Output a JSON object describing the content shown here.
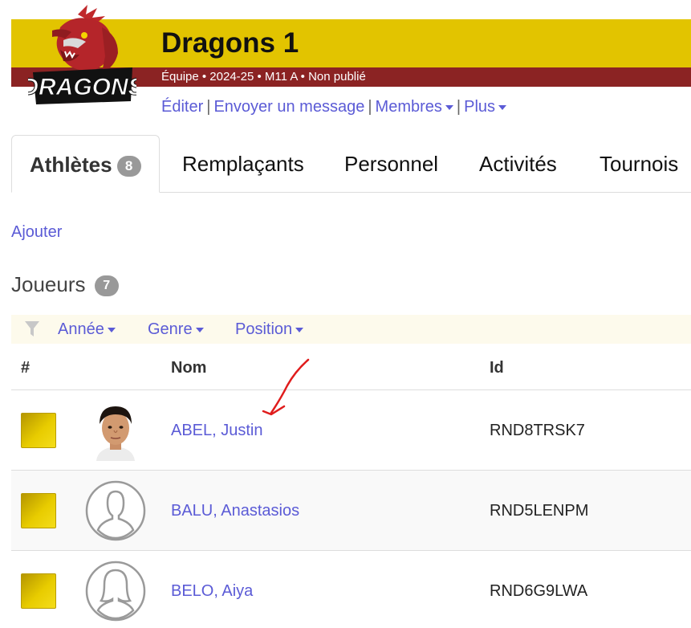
{
  "header": {
    "team_name": "Dragons 1",
    "meta": "Équipe • 2024-25 • M11 A • Non publié",
    "logo_text": "DRAGONS",
    "colors": {
      "primary": "#e2c400",
      "secondary": "#8b2323",
      "link": "#5b5bd6"
    }
  },
  "actions": {
    "edit": "Éditer",
    "send_message": "Envoyer un message",
    "members": "Membres",
    "more": "Plus",
    "separator": "|"
  },
  "tabs": [
    {
      "label": "Athlètes",
      "badge": "8",
      "active": true
    },
    {
      "label": "Remplaçants"
    },
    {
      "label": "Personnel"
    },
    {
      "label": "Activités"
    },
    {
      "label": "Tournois"
    }
  ],
  "add_label": "Ajouter",
  "section": {
    "title": "Joueurs",
    "count": "7"
  },
  "filters": {
    "icon": "filter-icon",
    "items": [
      "Année",
      "Genre",
      "Position"
    ]
  },
  "table": {
    "headers": {
      "number": "#",
      "name": "Nom",
      "id": "Id"
    },
    "rows": [
      {
        "name": "ABEL, Justin",
        "id": "RND8TRSK7",
        "avatar": "photo"
      },
      {
        "name": "BALU, Anastasios",
        "id": "RND5LENPM",
        "avatar": "male-placeholder-icon"
      },
      {
        "name": "BELO, Aiya",
        "id": "RND6G9LWA",
        "avatar": "female-placeholder-icon"
      }
    ]
  }
}
